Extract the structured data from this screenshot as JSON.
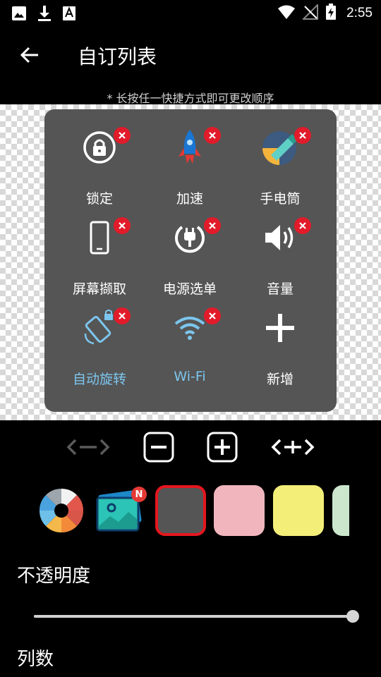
{
  "status_bar": {
    "time": "2:55",
    "icons": [
      "image-icon",
      "download-icon",
      "font-a-icon",
      "wifi-icon",
      "no-signal-icon",
      "battery-charging-icon"
    ]
  },
  "toolbar": {
    "back_icon": "arrow-left-icon",
    "title": "自订列表"
  },
  "hint": "* 长按任一快捷方式即可更改顺序",
  "tiles": [
    {
      "label": "锁定",
      "icon": "lock-icon",
      "removable": true,
      "label_color": "#ffffff"
    },
    {
      "label": "加速",
      "icon": "rocket-icon",
      "removable": true,
      "label_color": "#ffffff"
    },
    {
      "label": "手电筒",
      "icon": "flashlight-icon",
      "removable": true,
      "label_color": "#ffffff"
    },
    {
      "label": "屏幕撷取",
      "icon": "phone-screenshot-icon",
      "removable": true,
      "label_color": "#ffffff"
    },
    {
      "label": "电源选单",
      "icon": "power-plug-icon",
      "removable": true,
      "label_color": "#ffffff"
    },
    {
      "label": "音量",
      "icon": "volume-icon",
      "removable": true,
      "label_color": "#ffffff"
    },
    {
      "label": "自动旋转",
      "icon": "auto-rotate-icon",
      "removable": true,
      "label_color": "#7cc6ee"
    },
    {
      "label": "Wi-Fi",
      "icon": "wifi-icon",
      "removable": true,
      "label_color": "#7cc6ee"
    },
    {
      "label": "新增",
      "icon": "plus-icon",
      "removable": false,
      "label_color": "#ffffff"
    }
  ],
  "controls": [
    "shrink-width-icon",
    "minus-icon",
    "plus-icon",
    "expand-width-icon"
  ],
  "swatches": {
    "items": [
      {
        "name": "color-wheel",
        "color": ""
      },
      {
        "name": "wallpaper",
        "color": "",
        "badge": "N"
      },
      {
        "name": "gray",
        "color": "#555555",
        "selected": true
      },
      {
        "name": "pink",
        "color": "#f1b5bd"
      },
      {
        "name": "yellow",
        "color": "#f3ee78"
      },
      {
        "name": "mint",
        "color": "#cbe6cd"
      }
    ],
    "selected_border": "#e5161f"
  },
  "opacity": {
    "label": "不透明度",
    "value": 1.0
  },
  "columns_label": "列数",
  "colors": {
    "panel": "#555555",
    "remove_badge": "#e21b2a",
    "accent_blue": "#7cc6ee"
  }
}
